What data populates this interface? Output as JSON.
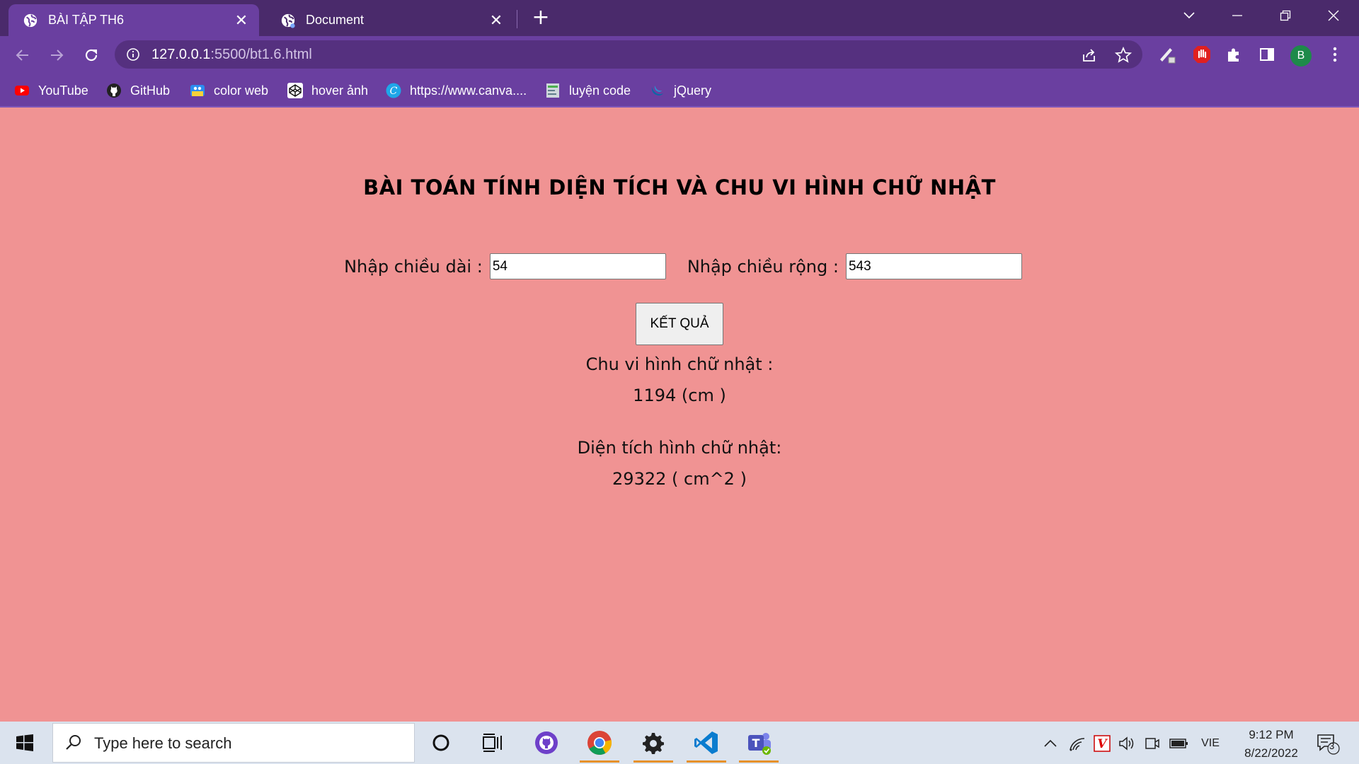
{
  "browser": {
    "tabs": [
      {
        "title": "BÀI TẬP TH6",
        "active": true
      },
      {
        "title": "Document",
        "active": false
      }
    ],
    "url_host": "127.0.0.1",
    "url_path": ":5500/bt1.6.html",
    "profile_initial": "B",
    "bookmarks": [
      {
        "label": "YouTube",
        "icon": "youtube-icon"
      },
      {
        "label": "GitHub",
        "icon": "github-icon"
      },
      {
        "label": "color web",
        "icon": "color-web-icon"
      },
      {
        "label": "hover ảnh",
        "icon": "codepen-icon"
      },
      {
        "label": "https://www.canva....",
        "icon": "canva-icon"
      },
      {
        "label": "luyện code",
        "icon": "code-icon"
      },
      {
        "label": "jQuery",
        "icon": "jquery-icon"
      }
    ]
  },
  "page": {
    "heading": "BÀI TOÁN TÍNH DIỆN TÍCH VÀ CHU VI HÌNH CHỮ NHẬT",
    "length_label": "Nhập chiều dài :",
    "length_value": "54",
    "width_label": "Nhập chiều rộng :",
    "width_value": "543",
    "button_label": "KẾT QUẢ",
    "perimeter_label": "Chu vi hình chữ nhật :",
    "perimeter_value": "1194 (cm )",
    "area_label": "Diện tích hình chữ nhật:",
    "area_value": "29322 ( cm^2 )"
  },
  "taskbar": {
    "search_placeholder": "Type here to search",
    "language": "VIE",
    "time": "9:12 PM",
    "date": "8/22/2022",
    "notification_count": "3"
  },
  "colors": {
    "page_background": "#f09393",
    "tab_strip": "#4a2a6b",
    "toolbar": "#6a3fa0"
  }
}
